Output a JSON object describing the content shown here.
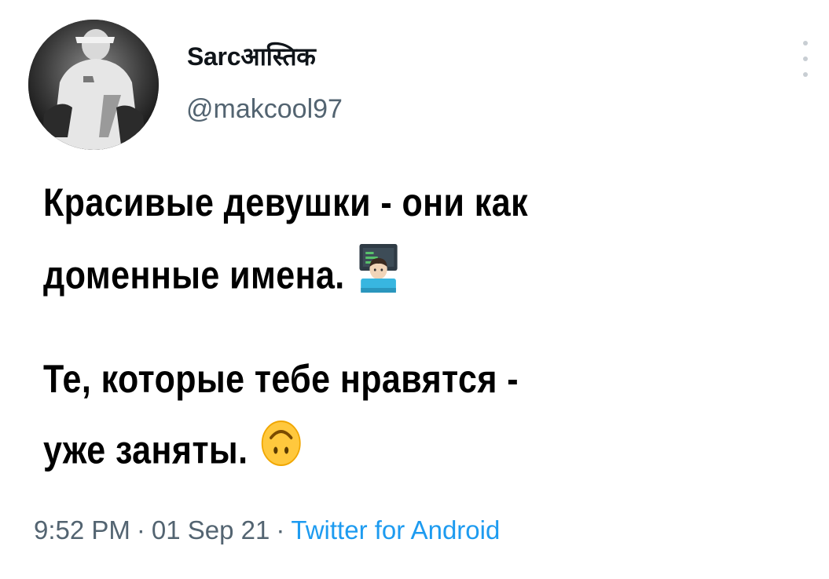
{
  "author": {
    "display_name": "Sarcआस्तिक",
    "handle": "@makcool97"
  },
  "tweet": {
    "paragraphs": [
      {
        "lines": [
          "Красивые девушки - они как",
          "доменные имена."
        ],
        "emoji": "technologist-emoji"
      },
      {
        "lines": [
          "Те, которые тебе нравятся -",
          "уже заняты."
        ],
        "emoji": "upside-down-face-emoji"
      }
    ]
  },
  "meta": {
    "time": "9:52 PM",
    "separator": "·",
    "date": "01 Sep 21",
    "source": "Twitter for Android"
  },
  "icons": {
    "more": "more-vertical-icon"
  },
  "colors": {
    "text": "#0f1419",
    "secondary": "#536471",
    "link": "#1d9bf0"
  }
}
